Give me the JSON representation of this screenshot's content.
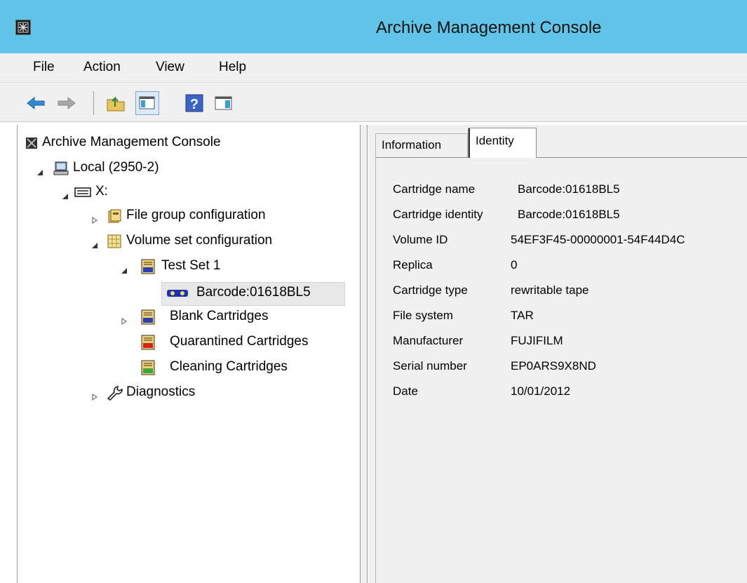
{
  "window": {
    "title": "Archive Management Console"
  },
  "menu": {
    "items": [
      "File",
      "Action",
      "View",
      "Help"
    ]
  },
  "toolbar": {
    "buttons": [
      {
        "icon": "back-arrow-icon"
      },
      {
        "icon": "forward-arrow-icon"
      },
      {
        "icon": "up-folder-icon"
      },
      {
        "icon": "show-hide-console-tree-icon"
      },
      {
        "icon": "help-icon"
      },
      {
        "icon": "show-hide-action-pane-icon"
      }
    ]
  },
  "tree": {
    "root": "Archive Management Console",
    "local": "Local (2950-2)",
    "drive": "X:",
    "file_group": "File group configuration",
    "volume_set": "Volume set configuration",
    "test_set": "Test Set 1",
    "barcode": "Barcode:01618BL5",
    "blank": "Blank Cartridges",
    "quarantined": "Quarantined Cartridges",
    "cleaning": "Cleaning Cartridges",
    "diagnostics": "Diagnostics"
  },
  "tabs": {
    "information": "Information",
    "identity": "Identity",
    "active": "Identity"
  },
  "properties": [
    {
      "label": "Cartridge name",
      "value": "Barcode:01618BL5"
    },
    {
      "label": "Cartridge identity",
      "value": "Barcode:01618BL5"
    },
    {
      "label": "Volume ID",
      "value": "54EF3F45-00000001-54F44D4C"
    },
    {
      "label": "Replica",
      "value": "0"
    },
    {
      "label": "Cartridge type",
      "value": "rewritable tape"
    },
    {
      "label": "File system",
      "value": "TAR"
    },
    {
      "label": "Manufacturer",
      "value": "FUJIFILM"
    },
    {
      "label": "Serial number",
      "value": "EP0ARS9X8ND"
    },
    {
      "label": "Date",
      "value": "10/01/2012"
    }
  ],
  "colors": {
    "titlebar": "#5fc4e8",
    "chrome": "#f0f0f0",
    "selection": "#e8e8e8"
  }
}
